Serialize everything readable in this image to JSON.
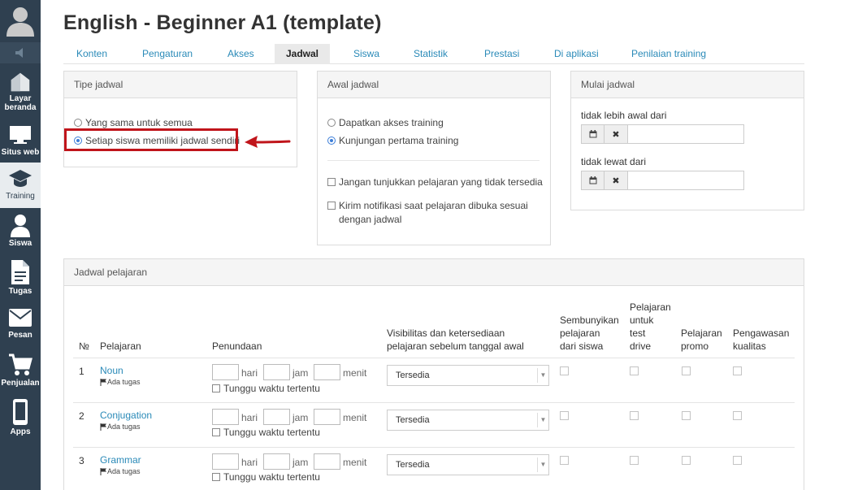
{
  "sidebar": {
    "items": [
      {
        "label": "Layar beranda",
        "icon": "home-icon"
      },
      {
        "label": "Situs web",
        "icon": "monitor-icon"
      },
      {
        "label": "Training",
        "icon": "graduation-cap-icon"
      },
      {
        "label": "Siswa",
        "icon": "user-icon"
      },
      {
        "label": "Tugas",
        "icon": "document-icon"
      },
      {
        "label": "Pesan",
        "icon": "envelope-icon"
      },
      {
        "label": "Penjualan",
        "icon": "cart-icon"
      },
      {
        "label": "Apps",
        "icon": "phone-icon"
      }
    ]
  },
  "page_title": "English - Beginner A1 (template)",
  "tabs": [
    "Konten",
    "Pengaturan",
    "Akses",
    "Jadwal",
    "Siswa",
    "Statistik",
    "Prestasi",
    "Di aplikasi",
    "Penilaian training"
  ],
  "active_tab": "Jadwal",
  "schedule_type": {
    "title": "Tipe jadwal",
    "options": [
      "Yang sama untuk semua",
      "Setiap siswa memiliki jadwal sendiri"
    ],
    "selected": "Setiap siswa memiliki jadwal sendiri"
  },
  "schedule_start": {
    "title": "Awal jadwal",
    "options": [
      "Dapatkan akses training",
      "Kunjungan pertama training"
    ],
    "selected": "Kunjungan pertama training",
    "checkbox1": "Jangan tunjukkan pelajaran yang tidak tersedia",
    "checkbox2_line1": "Kirim notifikasi saat pelajaran dibuka sesuai",
    "checkbox2_line2": "dengan jadwal"
  },
  "schedule_begin": {
    "title": "Mulai jadwal",
    "not_earlier": "tidak lebih awal dari",
    "not_later": "tidak lewat dari",
    "not_earlier_value": "",
    "not_later_value": ""
  },
  "lessons": {
    "title": "Jadwal pelajaran",
    "headers": {
      "num": "№",
      "lesson": "Pelajaran",
      "delay": "Penundaan",
      "visibility_l1": "Visibilitas dan ketersediaan",
      "visibility_l2": "pelajaran sebelum tanggal awal",
      "hide": [
        "Sembunyikan",
        "pelajaran",
        "dari siswa"
      ],
      "test": [
        "Pelajaran",
        "untuk",
        "test",
        "drive"
      ],
      "promo": [
        "Pelajaran",
        "promo"
      ],
      "quality": [
        "Pengawasan",
        "kualitas"
      ]
    },
    "units": {
      "day": "hari",
      "hour": "jam",
      "minute": "menit"
    },
    "wait_label": "Tunggu waktu tertentu",
    "rows": [
      {
        "num": "1",
        "name": "Noun",
        "tag": "Ada tugas",
        "visibility": "Tersedia"
      },
      {
        "num": "2",
        "name": "Conjugation",
        "tag": "Ada tugas",
        "visibility": "Tersedia"
      },
      {
        "num": "3",
        "name": "Grammar",
        "tag": "Ada tugas",
        "visibility": "Tersedia"
      }
    ]
  },
  "colors": {
    "sidebar": "#2f4050",
    "link": "#2a8ab8",
    "highlight": "#c0151b"
  }
}
